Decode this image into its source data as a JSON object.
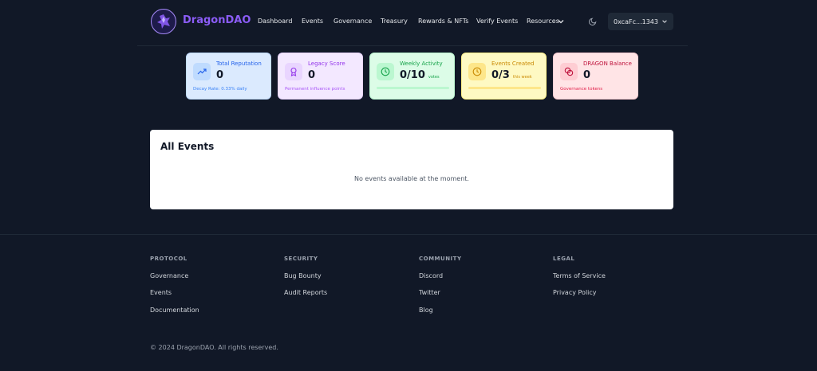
{
  "header": {
    "brand": "DragonDAO",
    "nav": [
      "Dashboard",
      "Events",
      "Governance",
      "Treasury",
      "Rewards & NFTs",
      "Verify Events",
      "Resources"
    ],
    "wallet": "0xcaFc...1343"
  },
  "stats": [
    {
      "label": "Total Reputation",
      "value": "0",
      "sub": "Decay Rate: 0.33% daily",
      "icon": "trending-up-icon",
      "accent": "#2563eb"
    },
    {
      "label": "Legacy Score",
      "value": "0",
      "sub": "Permanent influence points",
      "icon": "award-icon",
      "accent": "#9333ea"
    },
    {
      "label": "Weekly Activity",
      "value": "0/10",
      "unit": "votes",
      "progress": 0,
      "icon": "clock-icon",
      "accent": "#16a34a"
    },
    {
      "label": "Events Created",
      "value": "0/3",
      "unit": "this week",
      "progress": 0,
      "icon": "clock-icon",
      "accent": "#ca8a04"
    },
    {
      "label": "DRAGON Balance",
      "value": "0",
      "sub": "Governance tokens",
      "icon": "coins-icon",
      "accent": "#be123c"
    }
  ],
  "events": {
    "title": "All Events",
    "empty": "No events available at the moment."
  },
  "footer": {
    "columns": [
      {
        "heading": "PROTOCOL",
        "links": [
          "Governance",
          "Events",
          "Documentation"
        ]
      },
      {
        "heading": "SECURITY",
        "links": [
          "Bug Bounty",
          "Audit Reports"
        ]
      },
      {
        "heading": "COMMUNITY",
        "links": [
          "Discord",
          "Twitter",
          "Blog"
        ]
      },
      {
        "heading": "LEGAL",
        "links": [
          "Terms of Service",
          "Privacy Policy"
        ]
      }
    ],
    "copyright": "© 2024 DragonDAO. All rights reserved."
  }
}
